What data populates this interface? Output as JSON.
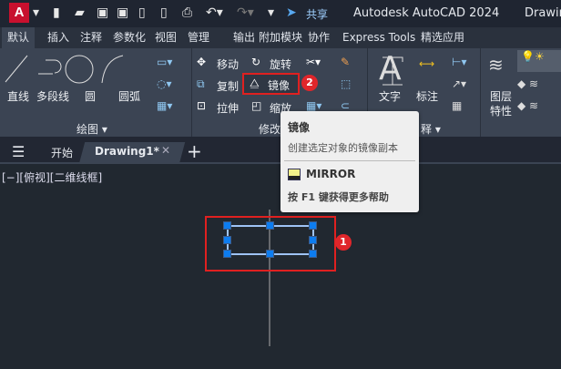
{
  "app": {
    "logo": "A",
    "share": "共享",
    "title": "Autodesk AutoCAD 2024",
    "doc_title": "Drawin"
  },
  "ribbon_tabs": [
    "默认",
    "插入",
    "注释",
    "参数化",
    "视图",
    "管理",
    "输出",
    "附加模块",
    "协作",
    "Express Tools",
    "精选应用"
  ],
  "draw_panel": {
    "tools": [
      "直线",
      "多段线",
      "圆",
      "圆弧"
    ],
    "label": "绘图"
  },
  "modify_panel": {
    "tools": [
      "移动",
      "旋转",
      "复制",
      "镜像",
      "拉伸",
      "缩放"
    ],
    "label": "修改"
  },
  "annot_panel": {
    "tools": [
      "文字",
      "标注"
    ],
    "label": "释"
  },
  "layer_panel": {
    "tools": [
      "图层",
      "特性"
    ]
  },
  "doc_tabs": {
    "start": "开始",
    "active": "Drawing1*"
  },
  "viewport_label": "[−][俯视][二维线框]",
  "tooltip": {
    "title": "镜像",
    "desc": "创建选定对象的镜像副本",
    "command": "MIRROR",
    "help": "按 F1 键获得更多帮助"
  },
  "badges": [
    "1",
    "2"
  ]
}
